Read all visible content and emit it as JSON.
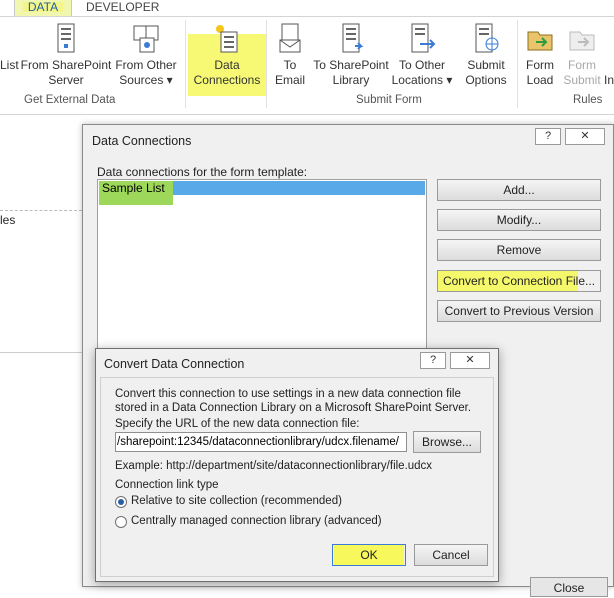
{
  "ribbon": {
    "tabs": [
      "DATA",
      "DEVELOPER"
    ],
    "buttons": [
      {
        "line1": "List",
        "line2": ""
      },
      {
        "line1": "From SharePoint",
        "line2": "Server"
      },
      {
        "line1": "From Other",
        "line2": "Sources ▾"
      },
      {
        "line1": "Data",
        "line2": "Connections"
      },
      {
        "line1": "To",
        "line2": "Email"
      },
      {
        "line1": "To SharePoint",
        "line2": "Library"
      },
      {
        "line1": "To Other",
        "line2": "Locations ▾"
      },
      {
        "line1": "Submit",
        "line2": "Options"
      },
      {
        "line1": "Form",
        "line2": "Load"
      },
      {
        "line1": "Form",
        "line2": "Submit"
      },
      {
        "line1": "In",
        "line2": ""
      }
    ],
    "groups": [
      "Get External Data",
      "Submit Form",
      "Rules"
    ]
  },
  "left_pane": {
    "text": "les"
  },
  "data_connections_dialog": {
    "title": "Data Connections",
    "help": "?",
    "close": "✕",
    "list_label": "Data connections for the form template:",
    "items": [
      "Sample List"
    ],
    "buttons": {
      "add": "Add...",
      "modify": "Modify...",
      "remove": "Remove",
      "convert": "Convert to Connection File...",
      "convert_prev": "Convert to Previous Version",
      "close": "Close"
    }
  },
  "convert_dialog": {
    "title": "Convert Data Connection",
    "help": "?",
    "close": "✕",
    "desc_line1": "Convert this connection to use settings in a new data connection file",
    "desc_line2": "stored in a Data Connection Library on a Microsoft SharePoint Server.",
    "url_label": "Specify the URL of the new data connection file:",
    "url_value": "/sharepoint:12345/dataconnectionlibrary/udcx.filename/",
    "browse": "Browse...",
    "example": "Example: http://department/site/dataconnectionlibrary/file.udcx",
    "link_type_label": "Connection link type",
    "option_relative": "Relative to site collection (recommended)",
    "option_central": "Centrally managed connection library (advanced)",
    "selected_option": "relative",
    "ok": "OK",
    "cancel": "Cancel"
  },
  "colors": {
    "highlight_yellow": "#f6f85c",
    "highlight_green": "#9ed85a",
    "selection_blue": "#58a9e8"
  }
}
